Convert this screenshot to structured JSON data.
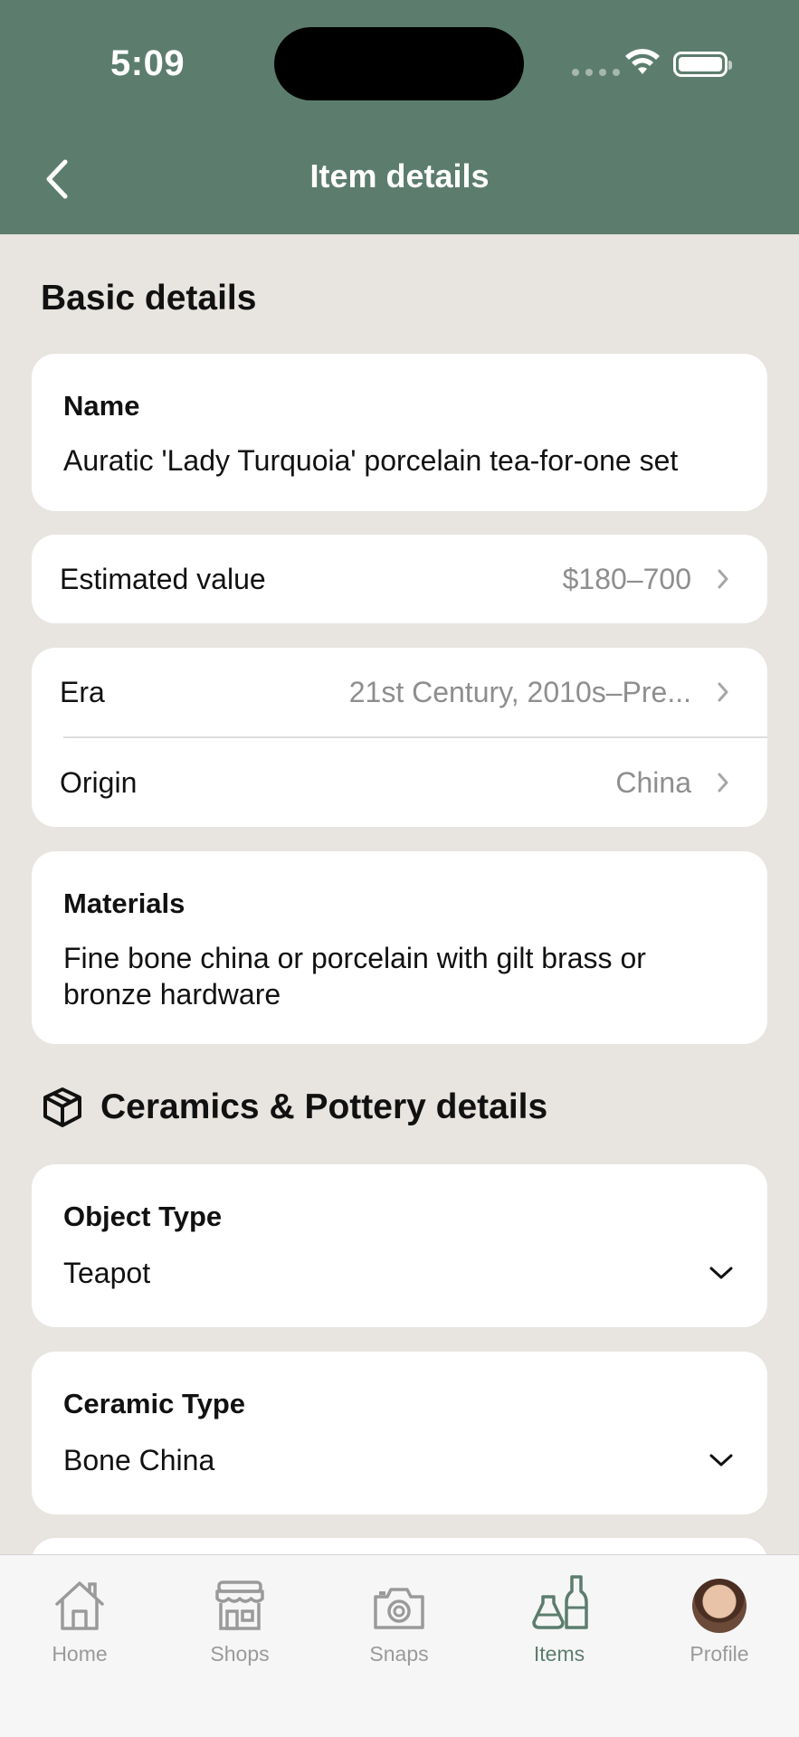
{
  "status_bar": {
    "time": "5:09"
  },
  "header": {
    "title": "Item details"
  },
  "basic": {
    "section_title": "Basic details",
    "name_label": "Name",
    "name_value": "Auratic 'Lady Turquoia' porcelain tea-for-one set",
    "estimated_value_label": "Estimated value",
    "estimated_value": "$180–700",
    "era_label": "Era",
    "era_value": "21st Century, 2010s–Pre...",
    "origin_label": "Origin",
    "origin_value": "China",
    "materials_label": "Materials",
    "materials_value": "Fine bone china or porcelain with gilt brass or bronze hardware"
  },
  "ceramics": {
    "section_title": "Ceramics & Pottery details",
    "object_type_label": "Object Type",
    "object_type_value": "Teapot",
    "ceramic_type_label": "Ceramic Type",
    "ceramic_type_value": "Bone China"
  },
  "tabbar": {
    "tabs": [
      {
        "label": "Home",
        "icon": "home-icon"
      },
      {
        "label": "Shops",
        "icon": "shop-icon"
      },
      {
        "label": "Snaps",
        "icon": "camera-icon"
      },
      {
        "label": "Items",
        "icon": "vases-icon",
        "active": true
      },
      {
        "label": "Profile",
        "icon": "avatar"
      }
    ]
  },
  "colors": {
    "header_bg": "#5C7D6E",
    "page_bg": "#E8E5E0",
    "accent": "#5C7D6E"
  }
}
